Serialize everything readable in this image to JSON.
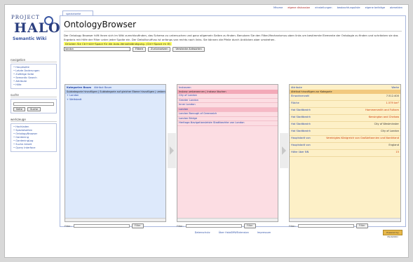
{
  "topbar": [
    "Mhome",
    "eigene diskussion",
    "einstellungen",
    "beobachtungsliste",
    "eigene beiträge",
    "abmelden"
  ],
  "tab_label": "spezialseite",
  "logo": {
    "project": "PROJECT",
    "halo": "HALO",
    "sub": "Semantic Wiki"
  },
  "title": "OntologyBrowser",
  "intro": "Der Ontology Browser hilft Ihnen sich im Wiki zurechtzufinden, das Schema zu untersuchen und ganz allgemein Seiten zu finden. Benutzen Sie den Filter-Mechanismus oben links um bestimmte Elemente der Ontologie zu finden und schränken sie das Ergebnis mit Hilfe der Filter unter jeder Spalte ein. Der Detaillsnuffuss ist anfangs von rechts nach links. Sie können die Pfeile durch Anklicken aber umdrehen.",
  "hint": "Drücken Sie Ctrl+Alt+Space für die Auto-Vervollständigung. (Ctrl+Space im IE)",
  "filter": {
    "value": "london",
    "btn_filter": "Filtere",
    "btn_reset": "Zurücksetzen",
    "btn_hide": "Verstecke Antworten"
  },
  "sidebar": {
    "nav_title": "navigation",
    "nav": [
      "Hauptseite",
      "Letzte Änderungen",
      "Zufällige Seite",
      "Semantic Search",
      "Attribute",
      "Hilfe"
    ],
    "search_title": "suche",
    "search_btn_go": "Seite",
    "search_btn_search": "Suche",
    "tools_title": "werkzeuge",
    "tools": [
      "Hochladen",
      "Spezialseiten",
      "OntologyBrowser",
      "Gardening",
      "GardeningLog",
      "Suche Arbeit",
      "Query Interface"
    ]
  },
  "categories": {
    "tab_active": "Kategorien Baum",
    "tab_other": "Attribut Baum",
    "header": "Subkategorie hinzufügen | Subkategorie auf gleicher Ebene hinzufügen | umbenennen",
    "items": [
      "London",
      "Weltstadt"
    ],
    "filter_label": "Filter:",
    "filter_btn": "Filter"
  },
  "instances": {
    "title": "Instanzen",
    "header": "Instanz umbenennen | Instanz löschen",
    "items": [
      "City of London",
      "Greater London",
      "Inner London",
      "London",
      "London Borough of Greenwich",
      "London Bridge",
      "Heritage-Navigationsleiste Stadtbezirke von London"
    ],
    "selected_index": 3,
    "filter_label": "Filter:",
    "filter_btn": "Filter"
  },
  "properties": {
    "title": "Attribute",
    "title_right": "Werte",
    "header": "Attribut hinzufügen zur Kategorie",
    "rows": [
      {
        "k": "Einwohnerzahl",
        "v": "7.512.400",
        "dark": true
      },
      {
        "k": "Fläche",
        "v": "1.579 km²",
        "dark": false
      },
      {
        "k": "Hat Stadtbezirk",
        "v": "Hammersmith and Fulham",
        "dark": false
      },
      {
        "k": "Hat Stadtbezirk",
        "v": "Kensington and Chelsea",
        "dark": false
      },
      {
        "k": "Hat Stadtbezirk",
        "v": "City of Westminster",
        "dark": true
      },
      {
        "k": "Hat Stadtbezirk",
        "v": "City of London",
        "dark": true
      },
      {
        "k": "Hauptstadt von",
        "v": "Vereinigtes Königreich von Großbritannien und Nordirland",
        "dark": false
      },
      {
        "k": "Hauptstadt von",
        "v": "England",
        "dark": true
      },
      {
        "k": "Höhe über NN",
        "v": "15",
        "dark": false
      }
    ],
    "filter_label": "Filter:",
    "filter_btn": "Filter"
  },
  "footer": [
    "Datenschutz",
    "Über HaloSMWExtension",
    "Impressum"
  ],
  "badge": "Powered by MediaWiki"
}
